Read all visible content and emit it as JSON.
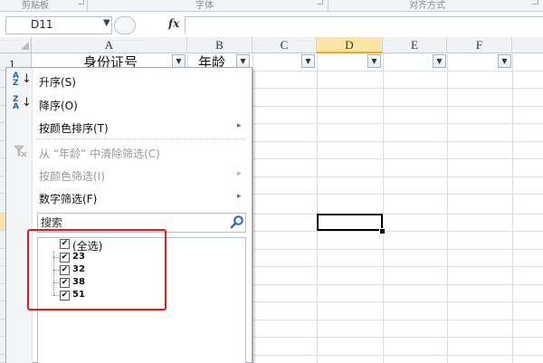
{
  "ribbon": {
    "groups": [
      "剪贴板",
      "字体",
      "对齐方式"
    ]
  },
  "formula_bar": {
    "name_box": "D11",
    "fx_label": "fx",
    "formula_value": ""
  },
  "columns": [
    "A",
    "B",
    "C",
    "D",
    "E",
    "F"
  ],
  "selected_column": "D",
  "row_numbers": [
    "1"
  ],
  "headers": {
    "a1": "身份证号",
    "b1": "年龄"
  },
  "filter_glyph": "▼",
  "filter_menu": {
    "sort_asc": "升序(S)",
    "sort_desc": "降序(O)",
    "sort_by_color": "按颜色排序(T)",
    "clear_filter": "从 “年龄” 中清除筛选(C)",
    "filter_by_color": "按颜色筛选(I)",
    "number_filter": "数字筛选(F)",
    "search_placeholder": "搜索",
    "select_all": "(全选)",
    "values": [
      "23",
      "32",
      "38",
      "51"
    ],
    "checked_glyph": "✔",
    "submenu_arrow": "▸",
    "sort_asc_icon_top": "A",
    "sort_asc_icon_bottom": "Z",
    "sort_desc_icon_top": "Z",
    "sort_desc_icon_bottom": "A",
    "sort_arrow": "↓"
  },
  "colors": {
    "highlight_box": "#e21b1b",
    "selected_header": "#fce4a6",
    "icon_blue": "#2a62b8"
  },
  "icons": [
    "search-icon",
    "filter-clear-icon",
    "sort-ascending-icon",
    "sort-descending-icon",
    "filter-dropdown-icon"
  ]
}
